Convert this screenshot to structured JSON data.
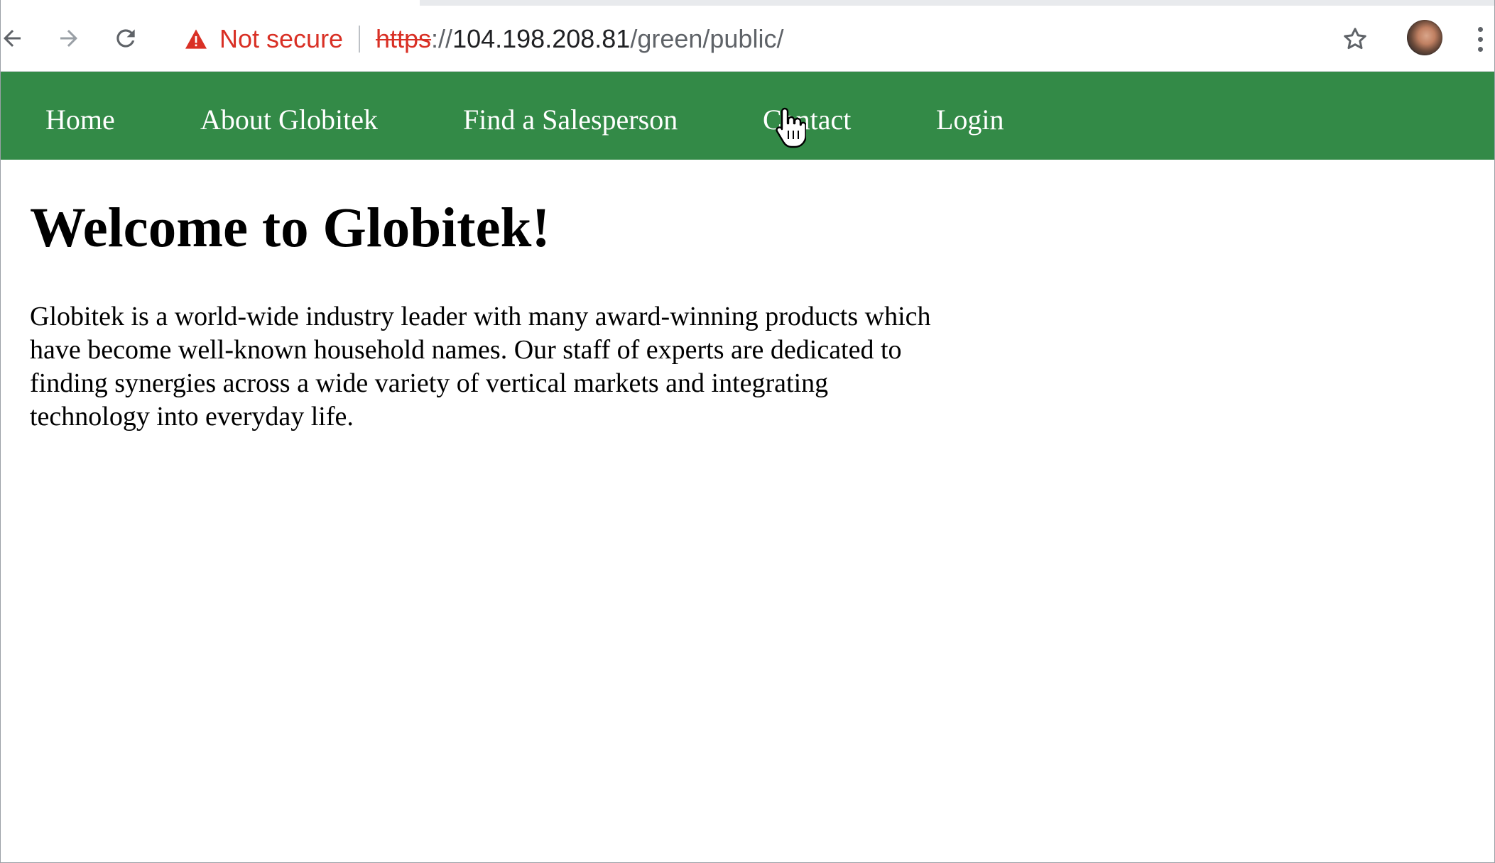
{
  "browser": {
    "security_label": "Not secure",
    "url": {
      "scheme": "https",
      "separator": "://",
      "host": "104.198.208.81",
      "path": "/green/public/"
    },
    "icons": {
      "back": "arrow-left-icon",
      "forward": "arrow-right-icon",
      "reload": "reload-icon",
      "warning": "warning-triangle-icon",
      "bookmark": "star-icon",
      "profile": "avatar-icon",
      "menu": "more-vertical-icon"
    }
  },
  "site_nav": {
    "color": "#338a47",
    "items": [
      {
        "label": "Home"
      },
      {
        "label": "About Globitek"
      },
      {
        "label": "Find a Salesperson"
      },
      {
        "label": "Contact"
      },
      {
        "label": "Login"
      }
    ]
  },
  "main": {
    "heading": "Welcome to Globitek!",
    "body": "Globitek is a world-wide industry leader with many award-winning products which have become well-known household names. Our staff of experts are dedicated to finding synergies across a wide variety of vertical markets and integrating technology into everyday life."
  }
}
